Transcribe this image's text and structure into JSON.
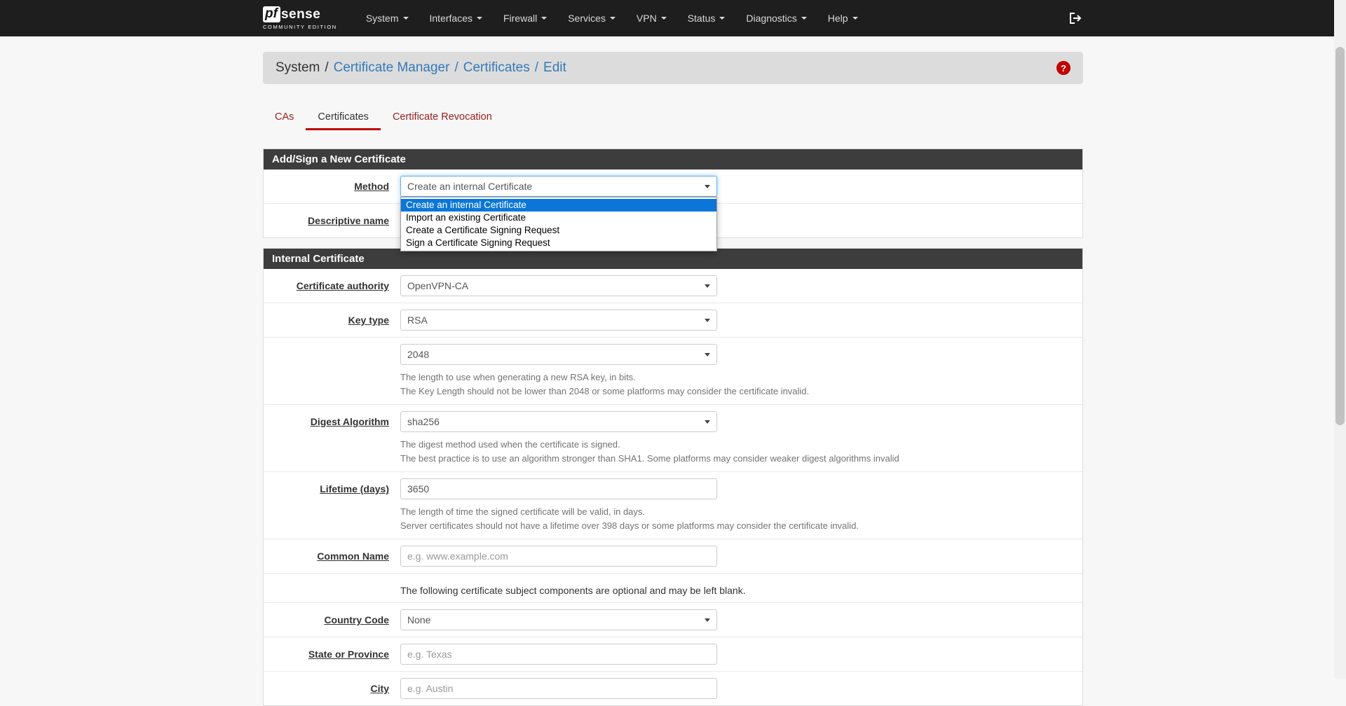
{
  "navbar": {
    "brand": {
      "pf": "pf",
      "sense": "sense",
      "edition": "COMMUNITY EDITION"
    },
    "items": [
      "System",
      "Interfaces",
      "Firewall",
      "Services",
      "VPN",
      "Status",
      "Diagnostics",
      "Help"
    ]
  },
  "breadcrumb": {
    "root": "System",
    "sep": "/",
    "links": [
      "Certificate Manager",
      "Certificates",
      "Edit"
    ],
    "help_glyph": "?"
  },
  "tabs": [
    "CAs",
    "Certificates",
    "Certificate Revocation"
  ],
  "add_panel": {
    "title": "Add/Sign a New Certificate",
    "method": {
      "label": "Method",
      "value": "Create an internal Certificate",
      "options": [
        "Create an internal Certificate",
        "Import an existing Certificate",
        "Create a Certificate Signing Request",
        "Sign a Certificate Signing Request"
      ]
    },
    "descriptive_name": {
      "label": "Descriptive name",
      "value": ""
    }
  },
  "internal_panel": {
    "title": "Internal Certificate",
    "certificate_authority": {
      "label": "Certificate authority",
      "value": "OpenVPN-CA"
    },
    "key_type": {
      "label": "Key type",
      "value": "RSA"
    },
    "key_length": {
      "value": "2048",
      "help": [
        "The length to use when generating a new RSA key, in bits.",
        "The Key Length should not be lower than 2048 or some platforms may consider the certificate invalid."
      ]
    },
    "digest_algorithm": {
      "label": "Digest Algorithm",
      "value": "sha256",
      "help": [
        "The digest method used when the certificate is signed.",
        "The best practice is to use an algorithm stronger than SHA1. Some platforms may consider weaker digest algorithms invalid"
      ]
    },
    "lifetime": {
      "label": "Lifetime (days)",
      "value": "3650",
      "help": [
        "The length of time the signed certificate will be valid, in days.",
        "Server certificates should not have a lifetime over 398 days or some platforms may consider the certificate invalid."
      ]
    },
    "common_name": {
      "label": "Common Name",
      "placeholder": "e.g. www.example.com"
    },
    "note": "The following certificate subject components are optional and may be left blank.",
    "country_code": {
      "label": "Country Code",
      "value": "None"
    },
    "state": {
      "label": "State or Province",
      "placeholder": "e.g. Texas"
    },
    "city": {
      "label": "City",
      "placeholder": "e.g. Austin"
    }
  }
}
